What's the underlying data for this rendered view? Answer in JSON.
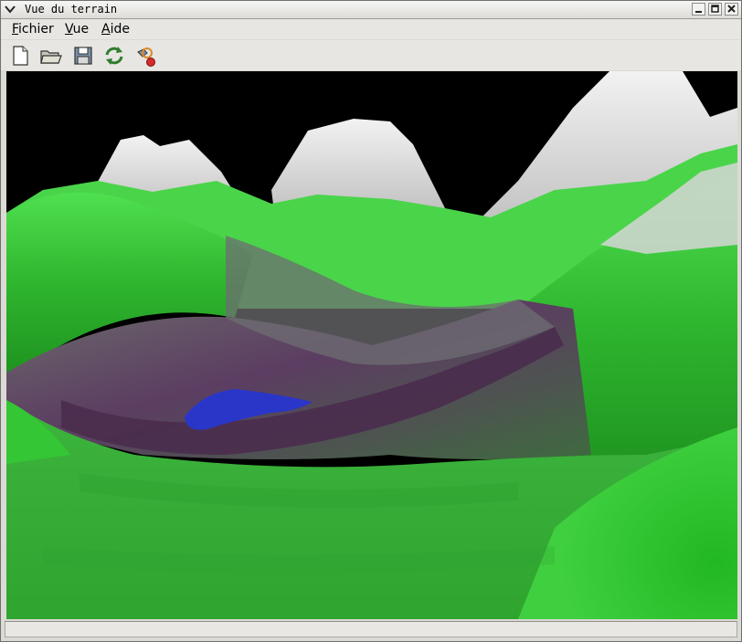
{
  "window": {
    "title": "Vue du terrain"
  },
  "menu": {
    "items": [
      {
        "label": "Fichier",
        "mnemonic": "F",
        "rest": "ichier"
      },
      {
        "label": "Vue",
        "mnemonic": "V",
        "rest": "ue"
      },
      {
        "label": "Aide",
        "mnemonic": "A",
        "rest": "ide"
      }
    ]
  },
  "toolbar": {
    "buttons": [
      {
        "icon": "new-file-icon"
      },
      {
        "icon": "open-folder-icon"
      },
      {
        "icon": "save-disk-icon"
      },
      {
        "icon": "refresh-icon"
      },
      {
        "icon": "tool-settings-icon"
      }
    ]
  },
  "statusbar": {
    "text": ""
  },
  "colors": {
    "grass": "#3fd23f",
    "snow": "#e8e8e8",
    "valley": "#5a3a5e",
    "water": "#2a36c8",
    "sky": "#000000"
  }
}
